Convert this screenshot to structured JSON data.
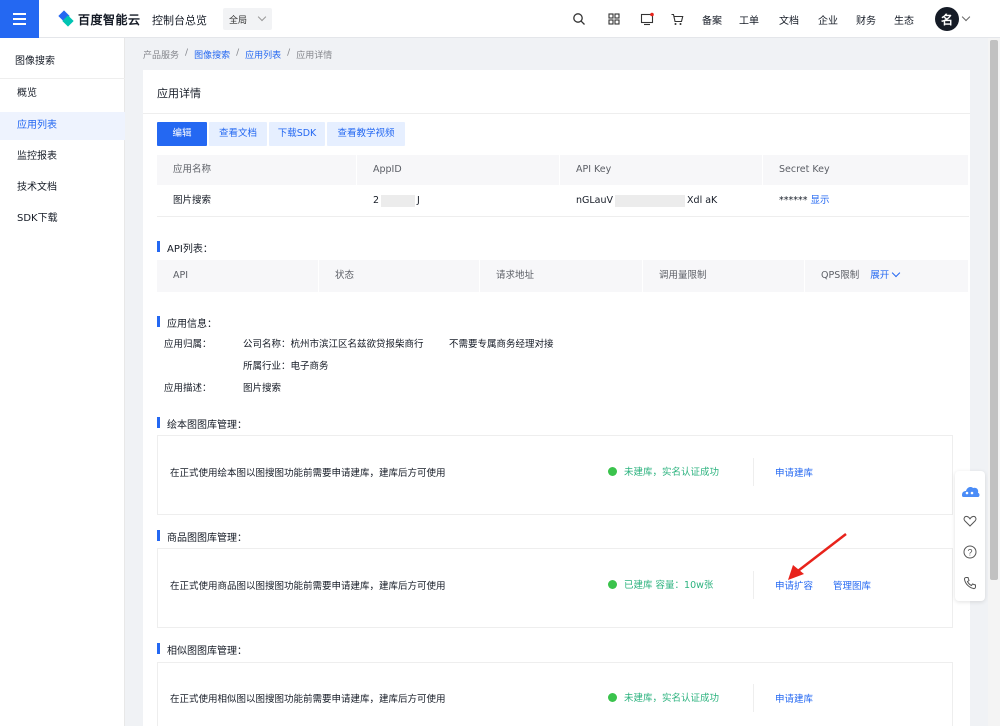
{
  "topbar": {
    "logo_text": "百度智能云",
    "console": "控制台总览",
    "region": "全局",
    "links": [
      "备案",
      "工单",
      "文档",
      "企业",
      "财务",
      "生态"
    ],
    "avatar": "名",
    "icons": [
      "search-icon",
      "grid-icon",
      "message-icon",
      "cart-icon"
    ]
  },
  "sidebar": {
    "title": "图像搜索",
    "items": [
      {
        "label": "概览"
      },
      {
        "label": "应用列表"
      },
      {
        "label": "监控报表"
      },
      {
        "label": "技术文档"
      },
      {
        "label": "SDK下载"
      }
    ]
  },
  "breadcrumb": {
    "items": [
      "产品服务",
      "图像搜索",
      "应用列表",
      "应用详情"
    ]
  },
  "detail": {
    "title": "应用详情",
    "buttons": [
      "编辑",
      "查看文档",
      "下载SDK",
      "查看教学视频"
    ],
    "table": {
      "headers": [
        "应用名称",
        "AppID",
        "API Key",
        "Secret Key"
      ],
      "row": {
        "name": "图片搜索",
        "appid_prefix": "2",
        "appid_suffix": "J",
        "apikey_prefix": "nGLauV",
        "apikey_suffix": "Xdl aK",
        "secret_mask": "******",
        "secret_action": "显示"
      }
    }
  },
  "api_list": {
    "title": "API列表：",
    "headers": [
      "API",
      "状态",
      "请求地址",
      "调用量限制",
      "QPS限制"
    ],
    "expand": "展开"
  },
  "app_info": {
    "title": "应用信息：",
    "belong_label": "应用归属：",
    "company": "公司名称：杭州市滨江区名兹欲贷报柴商行",
    "note": "不需要专属商务经理对接",
    "industry": "所属行业：电子商务",
    "desc_label": "应用描述：",
    "desc": "图片搜索"
  },
  "libraries": [
    {
      "title": "绘本图图库管理：",
      "text": "在正式使用绘本图以图搜图功能前需要申请建库，建库后方可使用",
      "status": "未建库，实名认证成功",
      "actions": [
        "申请建库"
      ]
    },
    {
      "title": "商品图图库管理：",
      "text": "在正式使用商品图以图搜图功能前需要申请建库，建库后方可使用",
      "status": "已建库 容量：10w张",
      "actions": [
        "申请扩容",
        "管理图库"
      ]
    },
    {
      "title": "相似图图库管理：",
      "text": "在正式使用相似图以图搜图功能前需要申请建库，建库后方可使用",
      "status": "未建库，实名认证成功",
      "actions": [
        "申请建库"
      ]
    }
  ],
  "float_bar": {
    "icons": [
      "cloud-assistant-icon",
      "heart-icon",
      "help-icon",
      "phone-icon"
    ]
  },
  "colors": {
    "primary": "#2468f2",
    "success": "#3ac34c",
    "annotation": "#e8231b"
  }
}
